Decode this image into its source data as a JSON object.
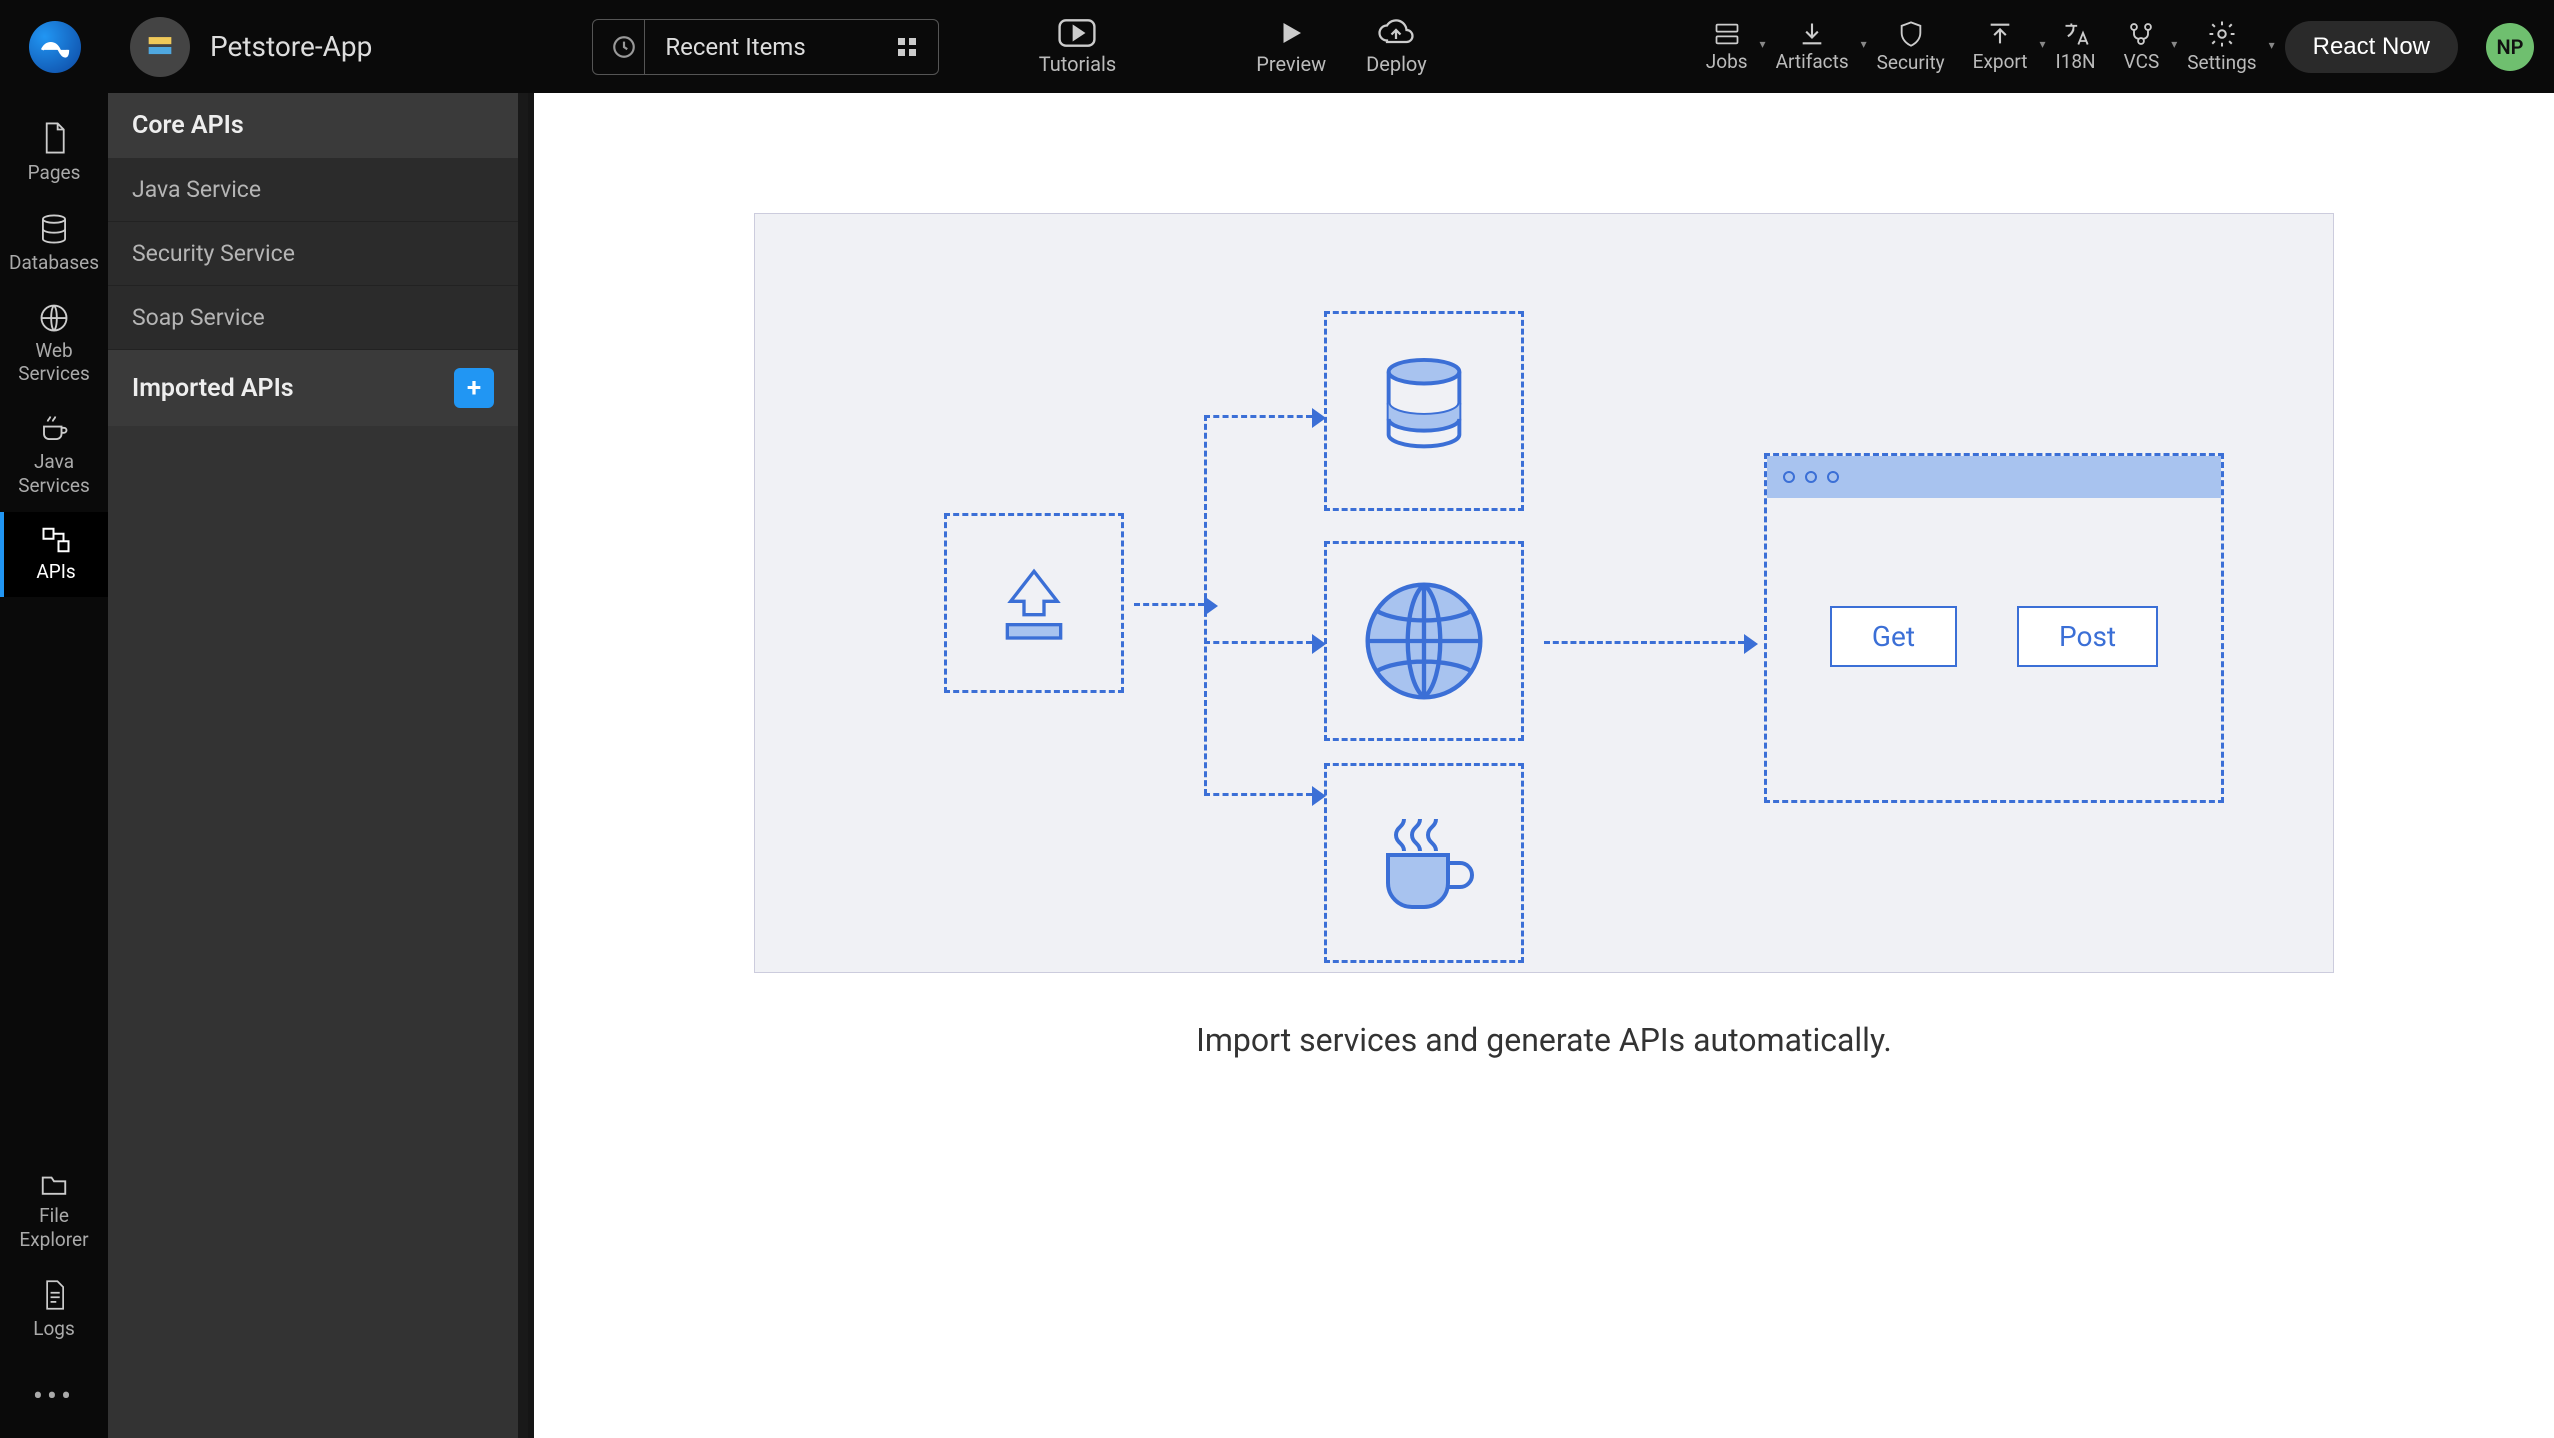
{
  "header": {
    "app_name": "Petstore-App",
    "recent_label": "Recent Items",
    "center": [
      {
        "label": "Tutorials"
      },
      {
        "label": "Preview"
      },
      {
        "label": "Deploy"
      }
    ],
    "right": [
      {
        "label": "Jobs"
      },
      {
        "label": "Artifacts"
      },
      {
        "label": "Security"
      },
      {
        "label": "Export"
      },
      {
        "label": "I18N"
      },
      {
        "label": "VCS"
      },
      {
        "label": "Settings"
      }
    ],
    "react_now": "React Now",
    "avatar_initials": "NP"
  },
  "rail": {
    "items": [
      {
        "label": "Pages"
      },
      {
        "label": "Databases"
      },
      {
        "label": "Web\nServices"
      },
      {
        "label": "Java\nServices"
      },
      {
        "label": "APIs"
      }
    ],
    "bottom": [
      {
        "label": "File\nExplorer"
      },
      {
        "label": "Logs"
      }
    ]
  },
  "sidepanel": {
    "section1_title": "Core APIs",
    "core_items": [
      "Java Service",
      "Security Service",
      "Soap Service"
    ],
    "section2_title": "Imported APIs"
  },
  "canvas": {
    "caption": "Import services and generate APIs automatically.",
    "get_label": "Get",
    "post_label": "Post"
  },
  "colors": {
    "accent": "#2196f3",
    "diagram": "#3b6fd6"
  }
}
